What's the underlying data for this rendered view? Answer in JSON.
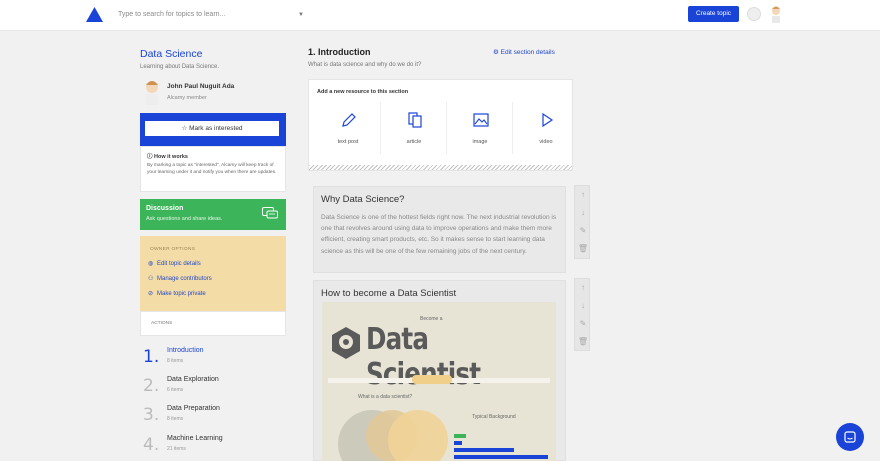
{
  "header": {
    "search_placeholder": "Type to search for topics to learn...",
    "create_label": "Create topic"
  },
  "topic": {
    "title": "Data Science",
    "subtitle": "Learning about Data Science."
  },
  "user": {
    "name": "John Paul Nuguit Ada",
    "role": "Alcamy member"
  },
  "interest": {
    "button_label": "Mark as interested",
    "how_title": "How it works",
    "how_text": "By marking a topic as \"interested\", Alcamy will keep track of your learning under it and notify you when there are updates."
  },
  "discussion": {
    "title": "Discussion",
    "subtitle": "Ask questions and share ideas."
  },
  "owner": {
    "title": "OWNER OPTIONS",
    "links": [
      "Edit topic details",
      "Manage contributors",
      "Make topic private"
    ],
    "actions_title": "ACTIONS"
  },
  "sections": [
    {
      "num": "1.",
      "name": "Introduction",
      "count": "8 items"
    },
    {
      "num": "2.",
      "name": "Data Exploration",
      "count": "6 items"
    },
    {
      "num": "3.",
      "name": "Data Preparation",
      "count": "8 items"
    },
    {
      "num": "4.",
      "name": "Machine Learning",
      "count": "21 items"
    }
  ],
  "section": {
    "heading": "1. Introduction",
    "description": "What is data science and why do we do it?",
    "edit_label": "Edit section details"
  },
  "add_resource": {
    "title": "Add a new resource to this section",
    "types": [
      "text post",
      "article",
      "image",
      "video"
    ]
  },
  "cards": [
    {
      "title": "Why Data Science?",
      "text": "Data Science is one of the hottest fields right now. The next industrial revolution is one that revolves around using data to improve operations and make them more efficient, creating smart products, etc. So it makes sense to start learning data science as this will be one of the few remaining jobs of the next century."
    },
    {
      "title": "How to become a Data Scientist"
    }
  ],
  "infographic": {
    "kicker": "Become a",
    "headline": "Data Scientist",
    "question": "What is a data scientist?",
    "background": "Typical Background"
  },
  "colors": {
    "brand": "#1a44d8",
    "discussion": "#3cb55a",
    "owner_panel": "#f4dca6"
  }
}
